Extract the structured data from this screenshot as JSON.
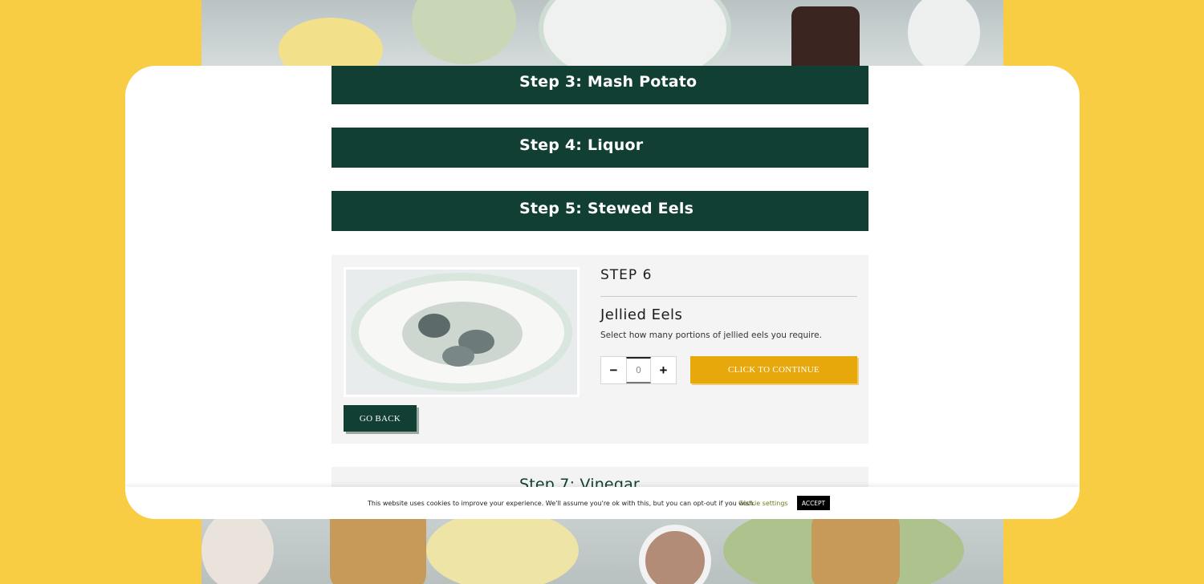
{
  "steps": {
    "step3_label": "Step 3: Mash Potato",
    "step4_label": "Step 4: Liquor",
    "step5_label": "Step 5: Stewed Eels",
    "step7_label": "Step 7: Vinegar"
  },
  "step6": {
    "heading": "STEP 6",
    "item_title": "Jellied Eels",
    "description": "Select how many portions of jellied eels you require.",
    "quantity_value": "0",
    "minus_symbol": "−",
    "plus_symbol": "+",
    "continue_label": "CLICK TO CONTINUE",
    "go_back_label": "GO BACK"
  },
  "cookie": {
    "text": "This website uses cookies to improve your experience. We'll assume you're ok with this, but you can opt-out if you wish.",
    "settings_label": "Cookie settings",
    "accept_label": "ACCEPT"
  },
  "colors": {
    "background": "#f8cd44",
    "step_bar": "#113f33",
    "continue_button": "#e7a80c"
  }
}
